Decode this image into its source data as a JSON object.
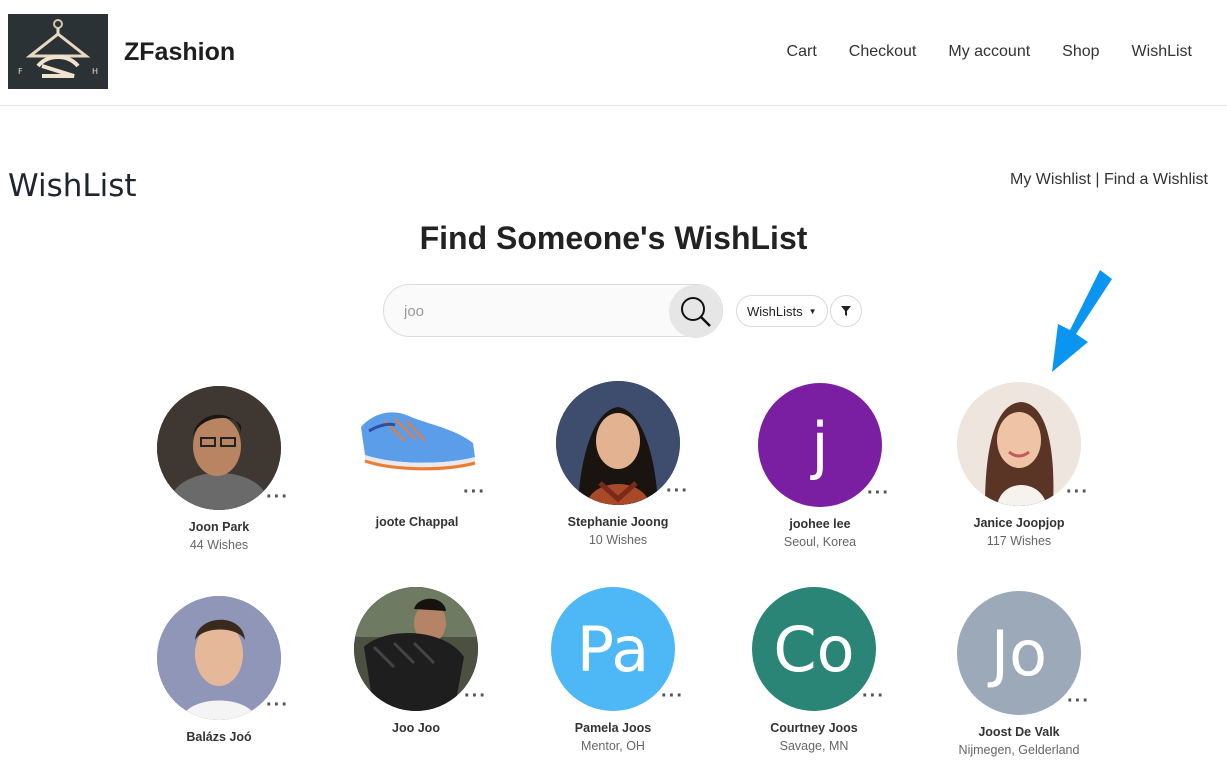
{
  "header": {
    "site_title": "ZFashion",
    "logo_left": "F",
    "logo_right": "H",
    "nav": [
      "Cart",
      "Checkout",
      "My account",
      "Shop",
      "WishList"
    ]
  },
  "page": {
    "title": "WishList",
    "link_my": "My Wishlist",
    "separator": "|",
    "link_find": "Find a Wishlist",
    "find_title": "Find Someone's WishList"
  },
  "search": {
    "value": "joo",
    "filter_select": "WishLists",
    "icons": {
      "search": "search-icon",
      "filter": "filter-icon"
    }
  },
  "colors": {
    "accent_arrow": "#0a96f0"
  },
  "results": [
    {
      "name": "Joon Park",
      "sub": "44 Wishes",
      "avatar": "photo"
    },
    {
      "name": "joote Chappal",
      "sub": "",
      "avatar": "shoe"
    },
    {
      "name": "Stephanie Joong",
      "sub": "10 Wishes",
      "avatar": "photo"
    },
    {
      "name": "joohee lee",
      "sub": "Seoul, Korea",
      "avatar": "letter",
      "initials": "j",
      "color": "#7b1fa2"
    },
    {
      "name": "Janice Joopjop",
      "sub": "117 Wishes",
      "avatar": "photo"
    },
    {
      "name": "Balázs Joó",
      "sub": "",
      "avatar": "photo"
    },
    {
      "name": "Joo Joo",
      "sub": "",
      "avatar": "photo"
    },
    {
      "name": "Pamela Joos",
      "sub": "Mentor, OH",
      "avatar": "letter",
      "initials": "Pa",
      "color": "#4db8f5"
    },
    {
      "name": "Courtney Joos",
      "sub": "Savage, MN",
      "avatar": "letter",
      "initials": "Co",
      "color": "#2a8577"
    },
    {
      "name": "Joost De Valk",
      "sub": "Nijmegen, Gelderland",
      "avatar": "letter",
      "initials": "Jo",
      "color": "#9ba9b8"
    }
  ]
}
